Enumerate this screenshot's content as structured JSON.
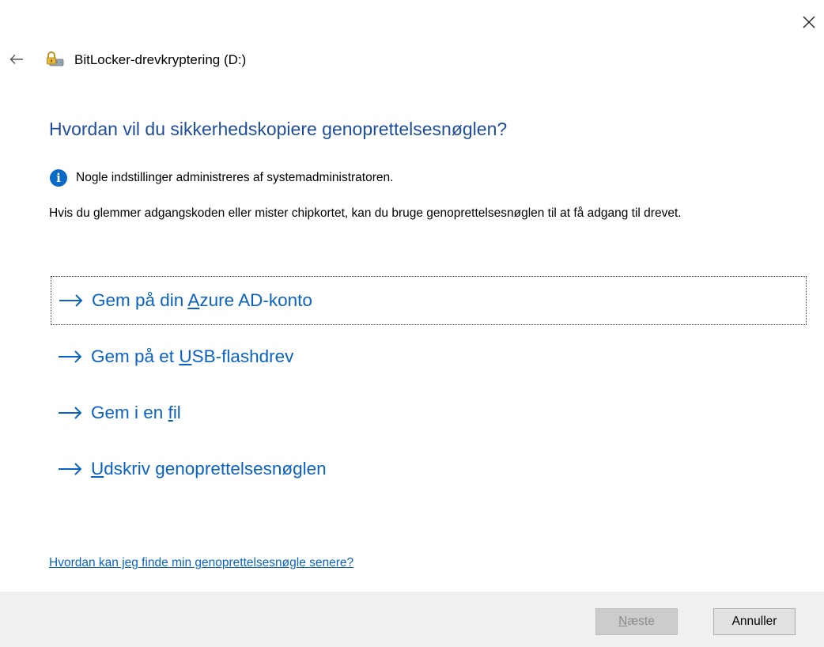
{
  "window": {
    "title": "BitLocker-drevkryptering (D:)",
    "close_icon": "close-icon",
    "back_icon": "back-arrow-icon",
    "app_icon": "bitlocker-drive-icon"
  },
  "main": {
    "heading": "Hvordan vil du sikkerhedskopiere genoprettelsesnøglen?",
    "info_icon": "info-icon",
    "info_text": "Nogle indstillinger administreres af systemadministratoren.",
    "description": "Hvis du glemmer adgangskoden eller mister chipkortet, kan du bruge genoprettelsesnøglen til at få adgang til drevet.",
    "options": [
      {
        "before": "Gem på din ",
        "key": "A",
        "after": "zure AD-konto",
        "focused": true
      },
      {
        "before": "Gem på et ",
        "key": "U",
        "after": "SB-flashdrev",
        "focused": false
      },
      {
        "before": "Gem i en ",
        "key": "f",
        "after": "il",
        "focused": false
      },
      {
        "before": "",
        "key": "U",
        "after": "dskriv genoprettelsesnøglen",
        "focused": false
      }
    ],
    "help_link": "Hvordan kan jeg finde min genoprettelsesnøgle senere?"
  },
  "footer": {
    "next": {
      "key": "N",
      "rest": "æste"
    },
    "cancel": "Annuller"
  },
  "colors": {
    "heading": "#1f4e9c",
    "link": "#0a63c4",
    "info": "#0b69c7",
    "footer_bg": "#f0f0f0"
  }
}
